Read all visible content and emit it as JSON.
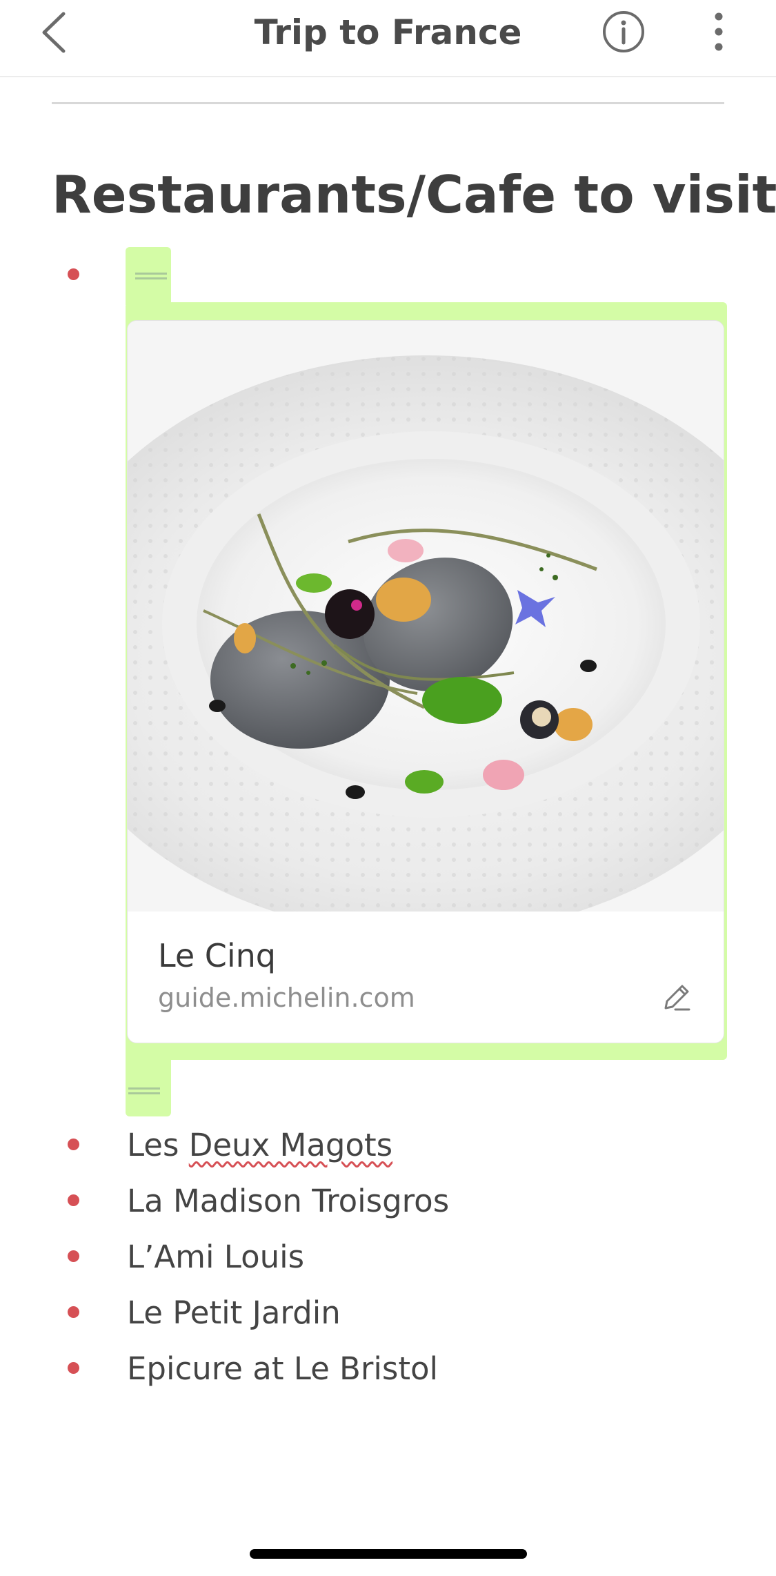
{
  "header": {
    "title": "Trip to France",
    "back_icon": "chevron-left-icon",
    "info_icon": "info-circle-icon",
    "more_icon": "vertical-ellipsis-icon"
  },
  "section": {
    "heading": "Restaurants/Cafe to visit"
  },
  "link_card": {
    "title": "Le Cinq",
    "url": "guide.michelin.com",
    "image": "plated-dish-photo",
    "edit_icon": "pencil-icon",
    "highlight_color": "#d4fca6"
  },
  "list": {
    "items": [
      {
        "prefix": "Les ",
        "misspelled": "Deux Magots",
        "suffix": ""
      },
      {
        "text": "La Madison Troisgros"
      },
      {
        "text": "L’Ami Louis"
      },
      {
        "text": "Le Petit Jardin"
      },
      {
        "text": "Epicure at Le Bristol"
      }
    ]
  },
  "colors": {
    "bullet": "#d65055",
    "highlight": "#d4fca6",
    "text": "#444444"
  }
}
